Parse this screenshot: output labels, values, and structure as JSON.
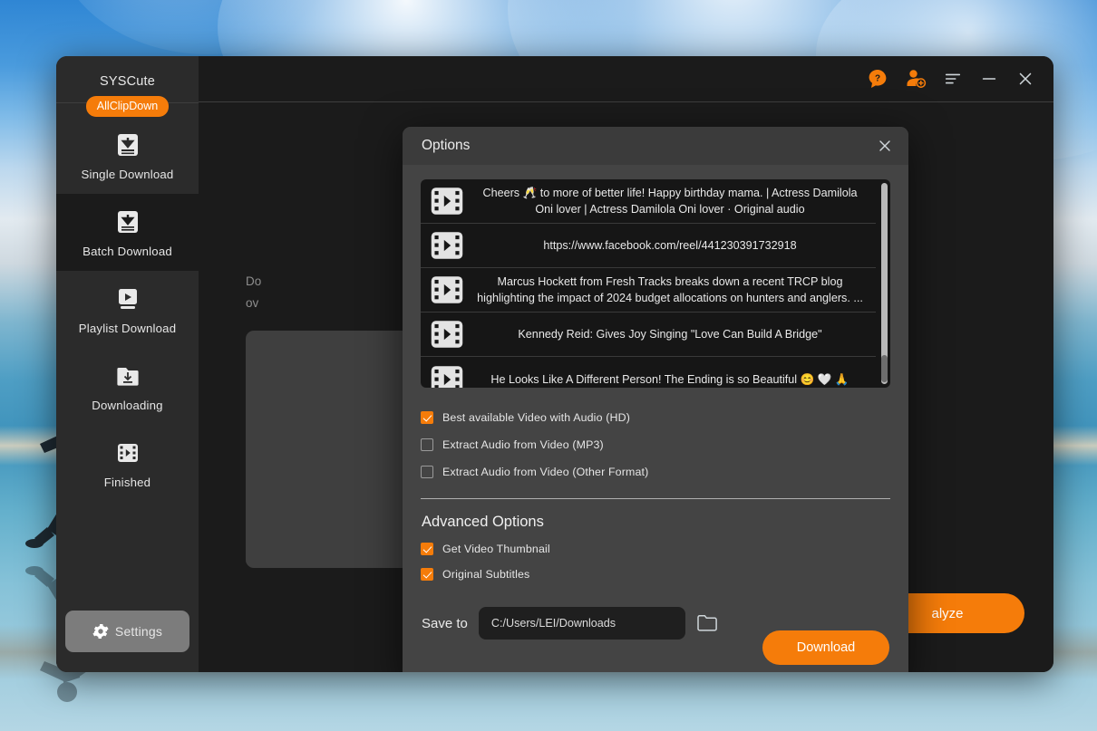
{
  "app": {
    "brand": "SYSCute",
    "badge": "AllClipDown"
  },
  "sidebar": {
    "items": [
      {
        "label": "Single Download",
        "icon": "download-box-icon"
      },
      {
        "label": "Batch Download",
        "icon": "download-batch-icon"
      },
      {
        "label": "Playlist Download",
        "icon": "playlist-play-icon"
      },
      {
        "label": "Downloading",
        "icon": "folder-download-icon"
      },
      {
        "label": "Finished",
        "icon": "film-icon"
      }
    ],
    "settings_label": "Settings",
    "settings_icon": "gear-icon"
  },
  "titlebar": {
    "icons": [
      "help-bubble-icon",
      "add-user-icon",
      "menu-list-icon",
      "minimize-icon",
      "close-icon"
    ]
  },
  "main": {
    "hint_line_1": "Do",
    "hint_line_2": "ov",
    "url_clear_icon": "clear-circle-icon",
    "analyze_label": "alyze"
  },
  "dialog": {
    "title": "Options",
    "close_icon": "close-icon",
    "videos": [
      {
        "icon": "film-icon",
        "title": "Cheers 🥂 to more of better life! Happy birthday mama. | Actress Damilola Oni lover | Actress Damilola Oni lover · Original audio"
      },
      {
        "icon": "film-icon",
        "title": "https://www.facebook.com/reel/441230391732918"
      },
      {
        "icon": "film-icon",
        "title": "Marcus Hockett from Fresh Tracks breaks down a recent TRCP blog highlighting the impact of 2024 budget allocations on hunters and anglers. ..."
      },
      {
        "icon": "film-icon",
        "title": "Kennedy Reid: Gives Joy Singing \"Love Can Build A Bridge\""
      },
      {
        "icon": "film-icon",
        "title": "He Looks Like A Different Person! The Ending is so Beautiful 😊 🤍 🙏"
      }
    ],
    "format_options": [
      {
        "label": "Best available Video with Audio (HD)",
        "checked": true
      },
      {
        "label": "Extract Audio from Video (MP3)",
        "checked": false
      },
      {
        "label": "Extract Audio from Video  (Other Format)",
        "checked": false
      }
    ],
    "advanced_title": "Advanced Options",
    "advanced_options": [
      {
        "label": "Get Video Thumbnail",
        "checked": true
      },
      {
        "label": "Original Subtitles",
        "checked": true
      }
    ],
    "saveto_label": "Save to",
    "saveto_value": "C:/Users/LEI/Downloads",
    "saveto_placeholder": "C:/Users/LEI/Downloads",
    "browse_icon": "folder-icon",
    "download_label": "Download"
  },
  "colors": {
    "accent": "#F57C0A",
    "dialog_bg": "#444444",
    "window_bg": "#1b1b1b",
    "sidebar_bg": "#2b2b2b",
    "list_bg": "#161616"
  }
}
